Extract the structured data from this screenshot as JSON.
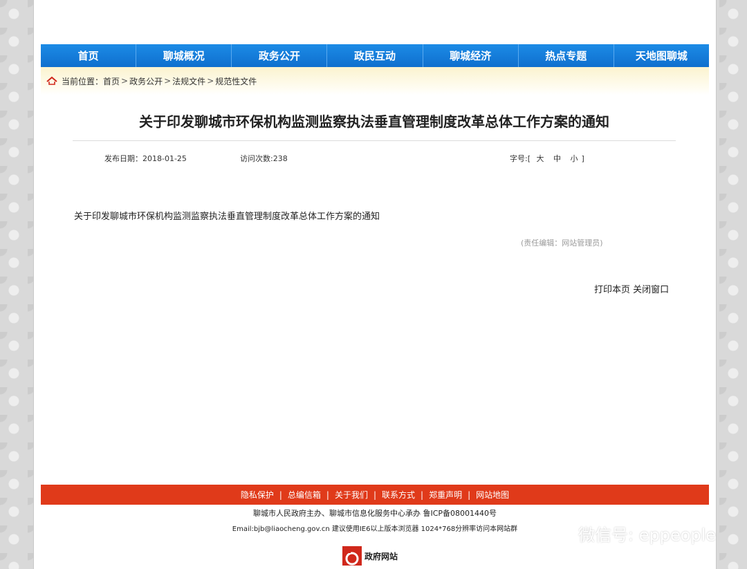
{
  "nav": {
    "items": [
      {
        "label": "首页"
      },
      {
        "label": "聊城概况"
      },
      {
        "label": "政务公开"
      },
      {
        "label": "政民互动"
      },
      {
        "label": "聊城经济"
      },
      {
        "label": "热点专题"
      },
      {
        "label": "天地图聊城"
      }
    ]
  },
  "breadcrumb": {
    "prefix": "当前位置：",
    "items": [
      "首页",
      "政务公开",
      "法规文件",
      "规范性文件"
    ],
    "separator": ">"
  },
  "article": {
    "title": "关于印发聊城市环保机构监测监察执法垂直管理制度改革总体工作方案的通知",
    "publish_label": "发布日期：",
    "publish_date": "2018-01-25",
    "visits_label": "访问次数:",
    "visits": "238",
    "font_size_label": "字号:",
    "font_size_open": "[",
    "font_size_large": "大",
    "font_size_medium": "中",
    "font_size_small": "小",
    "font_size_close": "]",
    "body": "关于印发聊城市环保机构监测监察执法垂直管理制度改革总体工作方案的通知",
    "editor": "(责任编辑：网站管理员)",
    "print_label": "打印本页",
    "close_label": "关闭窗口"
  },
  "footer": {
    "links": [
      "隐私保护",
      "总编信箱",
      "关于我们",
      "联系方式",
      "郑重声明",
      "网站地图"
    ],
    "host_line": "聊城市人民政府主办、聊城市信息化服务中心承办 鲁ICP备08001440号",
    "email_line": "Email:bjb@liaocheng.gov.cn 建议使用IE6以上版本浏览器 1024*768分辨率访问本网站群",
    "badge_label": "政府网站"
  },
  "watermark": {
    "label": "微信号: eppeople"
  },
  "colors": {
    "nav_blue": "#1c8be6",
    "footer_red": "#e03a1a",
    "crumb_bg": "#fbf3cf"
  }
}
